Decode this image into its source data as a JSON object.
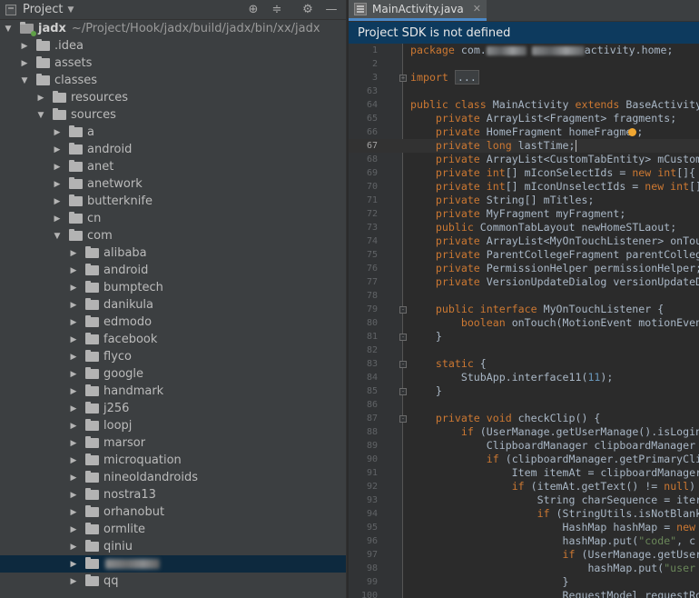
{
  "project_panel": {
    "title": "Project",
    "tools": [
      "target-icon",
      "collapse-icon",
      "gear-icon",
      "minimize-icon"
    ],
    "tree": [
      {
        "label": "jadx",
        "path": "~/Project/Hook/jadx/build/jadx/bin/xx/jadx",
        "depth": 0,
        "expanded": true,
        "root": true
      },
      {
        "label": ".idea",
        "depth": 1,
        "expanded": false
      },
      {
        "label": "assets",
        "depth": 1,
        "expanded": false
      },
      {
        "label": "classes",
        "depth": 1,
        "expanded": true
      },
      {
        "label": "resources",
        "depth": 2,
        "expanded": false
      },
      {
        "label": "sources",
        "depth": 2,
        "expanded": true
      },
      {
        "label": "a",
        "depth": 3,
        "expanded": false
      },
      {
        "label": "android",
        "depth": 3,
        "expanded": false
      },
      {
        "label": "anet",
        "depth": 3,
        "expanded": false
      },
      {
        "label": "anetwork",
        "depth": 3,
        "expanded": false
      },
      {
        "label": "butterknife",
        "depth": 3,
        "expanded": false
      },
      {
        "label": "cn",
        "depth": 3,
        "expanded": false
      },
      {
        "label": "com",
        "depth": 3,
        "expanded": true
      },
      {
        "label": "alibaba",
        "depth": 4,
        "expanded": false
      },
      {
        "label": "android",
        "depth": 4,
        "expanded": false
      },
      {
        "label": "bumptech",
        "depth": 4,
        "expanded": false
      },
      {
        "label": "danikula",
        "depth": 4,
        "expanded": false
      },
      {
        "label": "edmodo",
        "depth": 4,
        "expanded": false
      },
      {
        "label": "facebook",
        "depth": 4,
        "expanded": false
      },
      {
        "label": "flyco",
        "depth": 4,
        "expanded": false
      },
      {
        "label": "google",
        "depth": 4,
        "expanded": false
      },
      {
        "label": "handmark",
        "depth": 4,
        "expanded": false
      },
      {
        "label": "j256",
        "depth": 4,
        "expanded": false
      },
      {
        "label": "loopj",
        "depth": 4,
        "expanded": false
      },
      {
        "label": "marsor",
        "depth": 4,
        "expanded": false
      },
      {
        "label": "microquation",
        "depth": 4,
        "expanded": false
      },
      {
        "label": "nineoldandroids",
        "depth": 4,
        "expanded": false
      },
      {
        "label": "nostra13",
        "depth": 4,
        "expanded": false
      },
      {
        "label": "orhanobut",
        "depth": 4,
        "expanded": false
      },
      {
        "label": "ormlite",
        "depth": 4,
        "expanded": false
      },
      {
        "label": "qiniu",
        "depth": 4,
        "expanded": false
      },
      {
        "label": "",
        "depth": 4,
        "expanded": false,
        "selected": true,
        "redacted": true
      },
      {
        "label": "qq",
        "depth": 4,
        "expanded": false
      }
    ]
  },
  "editor": {
    "tab_label": "MainActivity.java",
    "banner": "Project SDK is not defined",
    "lines": [
      {
        "n": "1",
        "html": "<span class='k'>package</span> com.<span class='blur-code' style='width:44px'></span><span class='blur-code' style='width:58px;margin-left:6px'></span>activity.home;"
      },
      {
        "n": "2",
        "html": ""
      },
      {
        "n": "3",
        "html": "<span class='k'>import</span> <span class='ellip'>...</span>",
        "fold": "+"
      },
      {
        "n": "63",
        "html": ""
      },
      {
        "n": "64",
        "html": "<span class='k'>public class</span> MainActivity <span class='k'>extends</span> BaseActivity"
      },
      {
        "n": "65",
        "html": "    <span class='k'>private</span> ArrayList&lt;Fragment&gt; fragments;"
      },
      {
        "n": "66",
        "html": "    <span class='k'>private</span> HomeFragment homeFragme<span class='bulb'></span>;"
      },
      {
        "n": "67",
        "html": "    <span class='k'>private long</span> lastTime;<span class='cursor'></span>",
        "current": true
      },
      {
        "n": "68",
        "html": "    <span class='k'>private</span> ArrayList&lt;CustomTabEntity&gt; mCustom"
      },
      {
        "n": "69",
        "html": "    <span class='k'>private int</span>[] mIconSelectIds = <span class='k'>new int</span>[]{"
      },
      {
        "n": "70",
        "html": "    <span class='k'>private int</span>[] mIconUnselectIds = <span class='k'>new int</span>[]"
      },
      {
        "n": "71",
        "html": "    <span class='k'>private</span> String[] mTitles;"
      },
      {
        "n": "72",
        "html": "    <span class='k'>private</span> MyFragment myFragment;"
      },
      {
        "n": "73",
        "html": "    <span class='k'>public</span> CommonTabLayout newHomeSTLaout;"
      },
      {
        "n": "74",
        "html": "    <span class='k'>private</span> ArrayList&lt;MyOnTouchListener&gt; onTou"
      },
      {
        "n": "75",
        "html": "    <span class='k'>private</span> ParentCollegeFragment parentColleg"
      },
      {
        "n": "76",
        "html": "    <span class='k'>private</span> PermissionHelper permissionHelper;"
      },
      {
        "n": "77",
        "html": "    <span class='k'>private</span> VersionUpdateDialog versionUpdateD"
      },
      {
        "n": "78",
        "html": ""
      },
      {
        "n": "79",
        "html": "    <span class='k'>public interface</span> MyOnTouchListener {",
        "fold": "-"
      },
      {
        "n": "80",
        "html": "        <span class='k'>boolean</span> onTouch(MotionEvent motionEven"
      },
      {
        "n": "81",
        "html": "    }",
        "fold": "-"
      },
      {
        "n": "82",
        "html": ""
      },
      {
        "n": "83",
        "html": "    <span class='k'>static</span> {",
        "fold": "-"
      },
      {
        "n": "84",
        "html": "        StubApp.interface11(<span class='n'>11</span>);"
      },
      {
        "n": "85",
        "html": "    }",
        "fold": "-"
      },
      {
        "n": "86",
        "html": ""
      },
      {
        "n": "87",
        "html": "    <span class='k'>private void</span> checkClip() {",
        "fold": "-"
      },
      {
        "n": "88",
        "html": "        <span class='k'>if</span> (UserManage.getUserManage().isLogin"
      },
      {
        "n": "89",
        "html": "            ClipboardManager clipboardManager"
      },
      {
        "n": "90",
        "html": "            <span class='k'>if</span> (clipboardManager.getPrimaryCli"
      },
      {
        "n": "91",
        "html": "                Item itemAt = clipboardManager"
      },
      {
        "n": "92",
        "html": "                <span class='k'>if</span> (itemAt.getText() != <span class='k'>null</span>)"
      },
      {
        "n": "93",
        "html": "                    String charSequence = iter"
      },
      {
        "n": "94",
        "html": "                    <span class='k'>if</span> (StringUtils.isNotBlank"
      },
      {
        "n": "95",
        "html": "                        HashMap hashMap = <span class='k'>new</span>"
      },
      {
        "n": "96",
        "html": "                        hashMap.put(<span class='s'>\"code\"</span>, c"
      },
      {
        "n": "97",
        "html": "                        <span class='k'>if</span> (UserManage.getUser"
      },
      {
        "n": "98",
        "html": "                            hashMap.put(<span class='s'>\"user</span>"
      },
      {
        "n": "99",
        "html": "                        }"
      },
      {
        "n": "100",
        "html": "                        RequestModel requestRo"
      }
    ]
  }
}
